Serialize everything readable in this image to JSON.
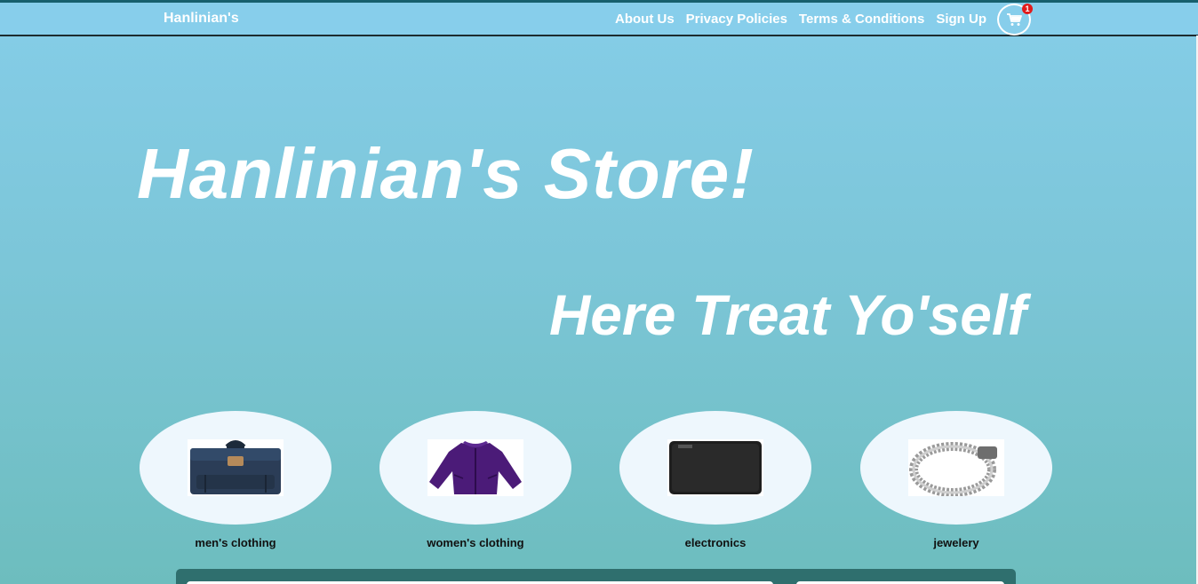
{
  "navbar": {
    "brand": "Hanlinian's",
    "links": [
      {
        "label": "About Us"
      },
      {
        "label": "Privacy Policies"
      },
      {
        "label": "Terms & Conditions"
      },
      {
        "label": "Sign Up"
      }
    ],
    "cart": {
      "icon": "shopping-cart-icon",
      "count": "1"
    }
  },
  "hero": {
    "title": "Hanlinian's Store!",
    "subtitle": "Here Treat Yo'self"
  },
  "categories": [
    {
      "label": "men's clothing",
      "image": "backpack"
    },
    {
      "label": "women's clothing",
      "image": "purple-jacket"
    },
    {
      "label": "electronics",
      "image": "external-hard-drive"
    },
    {
      "label": "jewelery",
      "image": "silver-bracelet"
    }
  ],
  "colors": {
    "navbar": "#87ceeb",
    "text": "#ffffff",
    "badge": "#e21b1b",
    "bottom_bar": "#2f6f6e"
  }
}
